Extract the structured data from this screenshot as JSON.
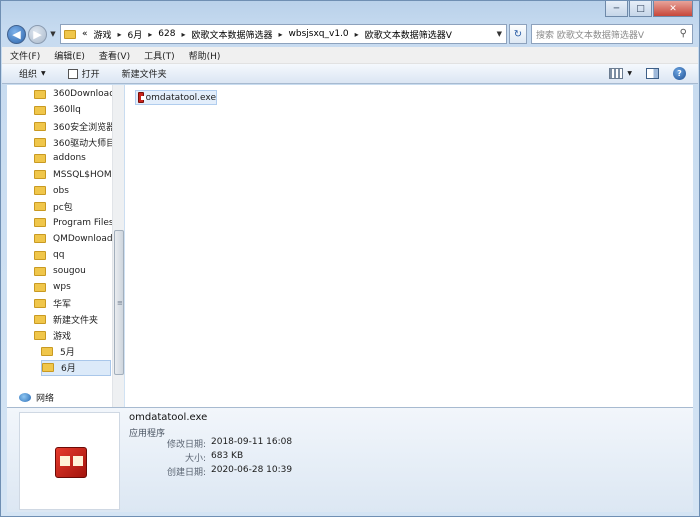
{
  "window": {
    "caption_buttons": {
      "minimize": "─",
      "maximize": "□",
      "close": "✕"
    }
  },
  "address_bar": {
    "chevron": "«",
    "breadcrumbs": [
      "游戏",
      "6月",
      "628",
      "欧歌文本数据筛选器",
      "wbsjsxq_v1.0",
      "欧歌文本数据筛选器V"
    ],
    "separator": "▸",
    "search_placeholder": "搜索 欧歌文本数据筛选器V"
  },
  "menu": [
    "文件(F)",
    "编辑(E)",
    "查看(V)",
    "工具(T)",
    "帮助(H)"
  ],
  "toolbar": {
    "organize": "组织",
    "open": "打开",
    "new_folder": "新建文件夹"
  },
  "nav_tree": [
    {
      "label": "360Downloads"
    },
    {
      "label": "360llq"
    },
    {
      "label": "360安全浏览器下"
    },
    {
      "label": "360驱动大师目录"
    },
    {
      "label": "addons"
    },
    {
      "label": "MSSQL$HOME"
    },
    {
      "label": "obs"
    },
    {
      "label": "pc包"
    },
    {
      "label": "Program Files ("
    },
    {
      "label": "QMDownload"
    },
    {
      "label": "qq"
    },
    {
      "label": "sougou"
    },
    {
      "label": "wps"
    },
    {
      "label": "华军"
    },
    {
      "label": "新建文件夹"
    },
    {
      "label": "游戏"
    },
    {
      "label": "5月"
    },
    {
      "label": "6月"
    }
  ],
  "network_label": "网络",
  "files": [
    {
      "name": "omdatatool.exe"
    }
  ],
  "details": {
    "name": "omdatatool.exe",
    "type": "应用程序",
    "rows": [
      {
        "label": "修改日期:",
        "value": "2018-09-11 16:08"
      },
      {
        "label": "大小:",
        "value": "683 KB"
      },
      {
        "label": "创建日期:",
        "value": "2020-06-28 10:39"
      }
    ]
  }
}
